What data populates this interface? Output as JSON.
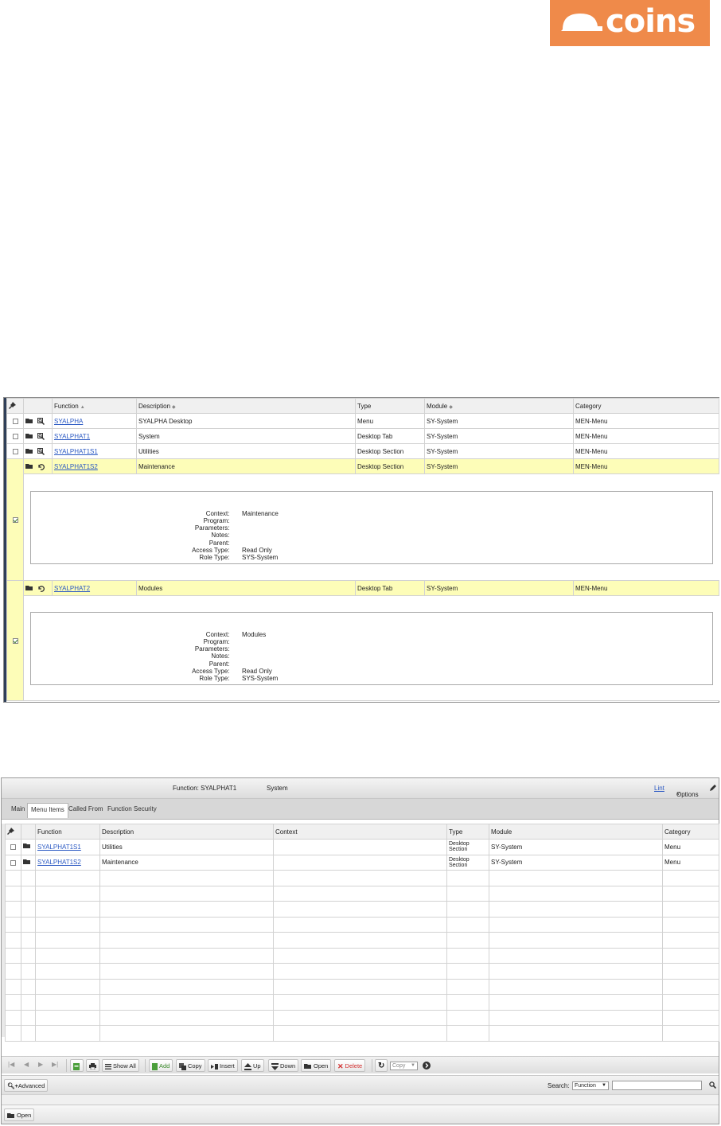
{
  "logo": {
    "text": "coins",
    "color": "#ef8a4a"
  },
  "panel1": {
    "columns": [
      "Function",
      "Description",
      "Type",
      "Module",
      "Category"
    ],
    "rows": [
      {
        "function": "SYALPHA",
        "description": "SYALPHA Desktop",
        "type": "Menu",
        "module": "SY-System",
        "category": "MEN-Menu",
        "checked": false,
        "icons": [
          "folder-icon",
          "zoom-icon"
        ]
      },
      {
        "function": "SYALPHAT1",
        "description": "System",
        "type": "Desktop Tab",
        "module": "SY-System",
        "category": "MEN-Menu",
        "checked": false,
        "icons": [
          "folder-icon",
          "zoom-icon"
        ]
      },
      {
        "function": "SYALPHAT1S1",
        "description": "Utilities",
        "type": "Desktop Section",
        "module": "SY-System",
        "category": "MEN-Menu",
        "checked": false,
        "icons": [
          "folder-icon",
          "zoom-icon"
        ]
      },
      {
        "function": "SYALPHAT1S2",
        "description": "Maintenance",
        "type": "Desktop Section",
        "module": "SY-System",
        "category": "MEN-Menu",
        "checked": true,
        "icons": [
          "folder-icon",
          "undo-icon"
        ]
      },
      {
        "function": "SYALPHAT2",
        "description": "Modules",
        "type": "Desktop Tab",
        "module": "SY-System",
        "category": "MEN-Menu",
        "checked": true,
        "icons": [
          "folder-icon",
          "undo-icon"
        ]
      }
    ],
    "detail_labels": [
      "Context:",
      "Program:",
      "Parameters:",
      "Notes:",
      "Parent:",
      "Access Type:",
      "Role Type:"
    ],
    "details": [
      [
        "Maintenance",
        "",
        "",
        "",
        "",
        "Read Only",
        "SYS-System"
      ],
      [
        "Modules",
        "",
        "",
        "",
        "",
        "Read Only",
        "SYS-System"
      ]
    ]
  },
  "panel2": {
    "title_label": "Function: SYALPHAT1",
    "title_desc": "System",
    "lint": "Lint",
    "options": "Options",
    "tabs": [
      "Main",
      "Menu Items",
      "Called From",
      "Function Security"
    ],
    "active_tab": 1,
    "columns": [
      "Function",
      "Description",
      "Context",
      "Type",
      "Module",
      "Category"
    ],
    "rows": [
      {
        "function": "SYALPHAT1S1",
        "description": "Utilities",
        "context": "",
        "type": "Desktop\nSection",
        "module": "SY-System",
        "category": "Menu"
      },
      {
        "function": "SYALPHAT1S2",
        "description": "Maintenance",
        "context": "",
        "type": "Desktop\nSection",
        "module": "SY-System",
        "category": "Menu"
      }
    ],
    "empty_rows": 11,
    "toolbar": {
      "show_all": "Show All",
      "add": "Add",
      "copy": "Copy",
      "insert": "Insert",
      "up": "Up",
      "down": "Down",
      "open": "Open",
      "delete": "Delete",
      "copy_select": "Copy"
    },
    "advanced": "Advanced",
    "search_label": "Search:",
    "search_field": "Function",
    "open_button": "Open"
  }
}
